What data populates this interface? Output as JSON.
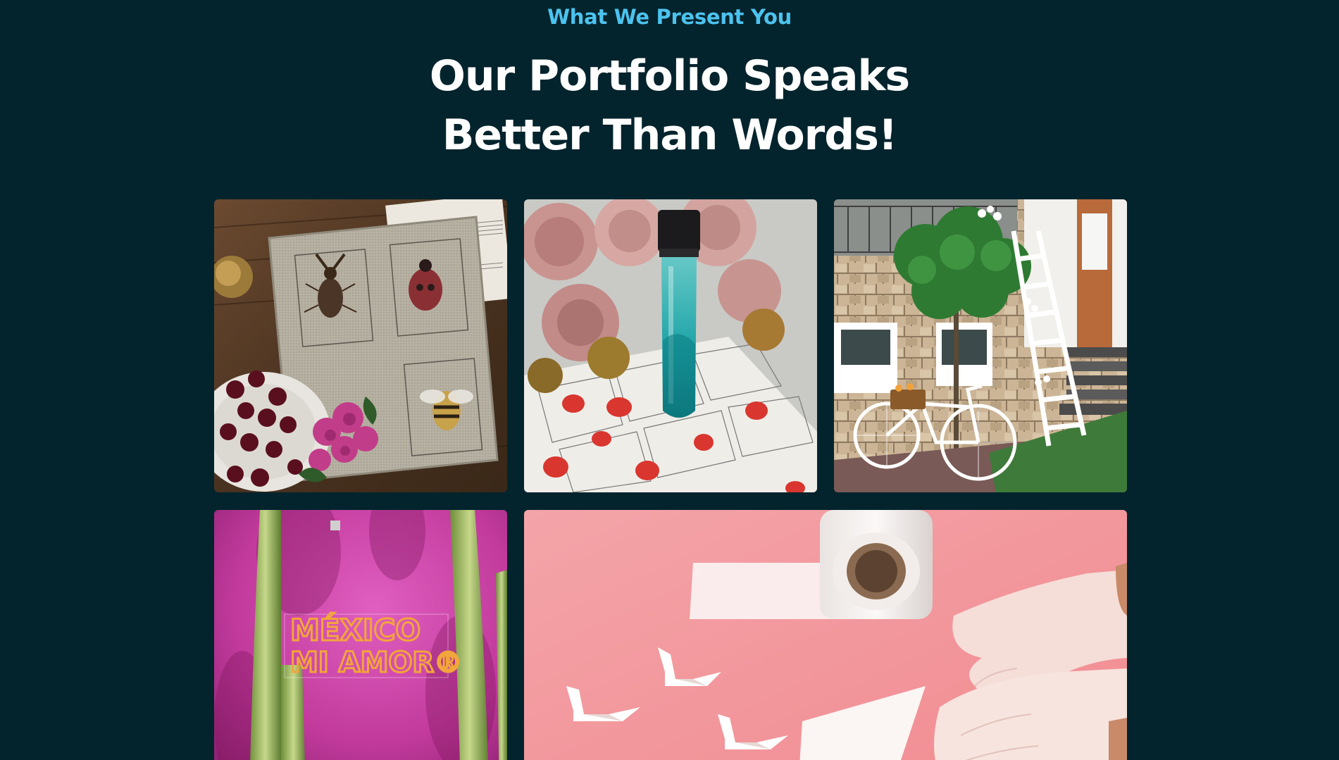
{
  "section": {
    "eyebrow": "What We Present You",
    "heading_line1": "Our Portfolio Speaks",
    "heading_line2": "Better Than Words!"
  },
  "portfolio": {
    "items": [
      {
        "image": "embroidered-insect-cards-with-cherries-and-flowers"
      },
      {
        "image": "perfume-bottle-with-peonies-on-comic-book"
      },
      {
        "image": "white-bicycle-and-ladder-outside-stone-house"
      },
      {
        "image": "neon-sign-on-pink-wall-with-cacti",
        "sign_text_line1": "MÉXICO",
        "sign_text_line2": "MI AMOR®"
      },
      {
        "image": "gloved-hands-folding-paper-swans-beside-paper-roll"
      }
    ]
  },
  "colors": {
    "background": "#03232d",
    "eyebrow": "#4cc3ee",
    "heading": "#ffffff"
  }
}
